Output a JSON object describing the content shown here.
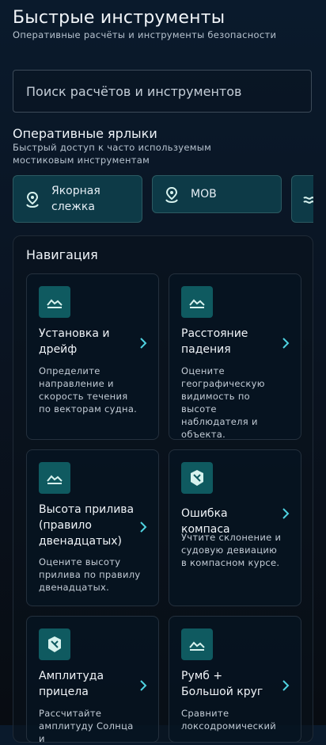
{
  "header": {
    "title": "Быстрые инструменты",
    "subtitle": "Оперативные расчёты и инструменты безопасности"
  },
  "search": {
    "placeholder": "Поиск расчётов и инструментов"
  },
  "shortcuts": {
    "title": "Оперативные ярлыки",
    "description": "Быстрый доступ к часто используемым мостиковым инструментам",
    "items": [
      {
        "label": "Якорная слежка",
        "icon": "location-pin-icon"
      },
      {
        "label": "MOB",
        "icon": "location-pin-icon"
      },
      {
        "label": "",
        "icon": "wave-icon"
      }
    ]
  },
  "navigation": {
    "title": "Навигация",
    "cards": [
      {
        "title": "Установка и дрейф",
        "description": "Определите направление и скорость течения по векторам судна.",
        "icon": "waves-icon"
      },
      {
        "title": "Расстояние падения",
        "description": "Оцените географическую видимость по высоте наблюдателя и объекта.",
        "icon": "waves-icon"
      },
      {
        "title": "Высота прилива (правило двенадцатых)",
        "description": "Оцените высоту прилива по правилу двенадцатых.",
        "icon": "waves-icon"
      },
      {
        "title": "Ошибка компаса",
        "description": "Учтите склонение и судовую девиацию в компасном курсе.",
        "icon": "compass-icon"
      },
      {
        "title": "Амплитуда прицела",
        "description": "Рассчитайте амплитуду Солнца и",
        "icon": "compass-icon"
      },
      {
        "title": "Румб + Большой круг",
        "description": "Сравните локсодромический",
        "icon": "waves-icon"
      }
    ]
  },
  "colors": {
    "accent": "#0f5a60",
    "chip_bg": "#0d3a47",
    "icon_fg": "#d7f2ee"
  }
}
